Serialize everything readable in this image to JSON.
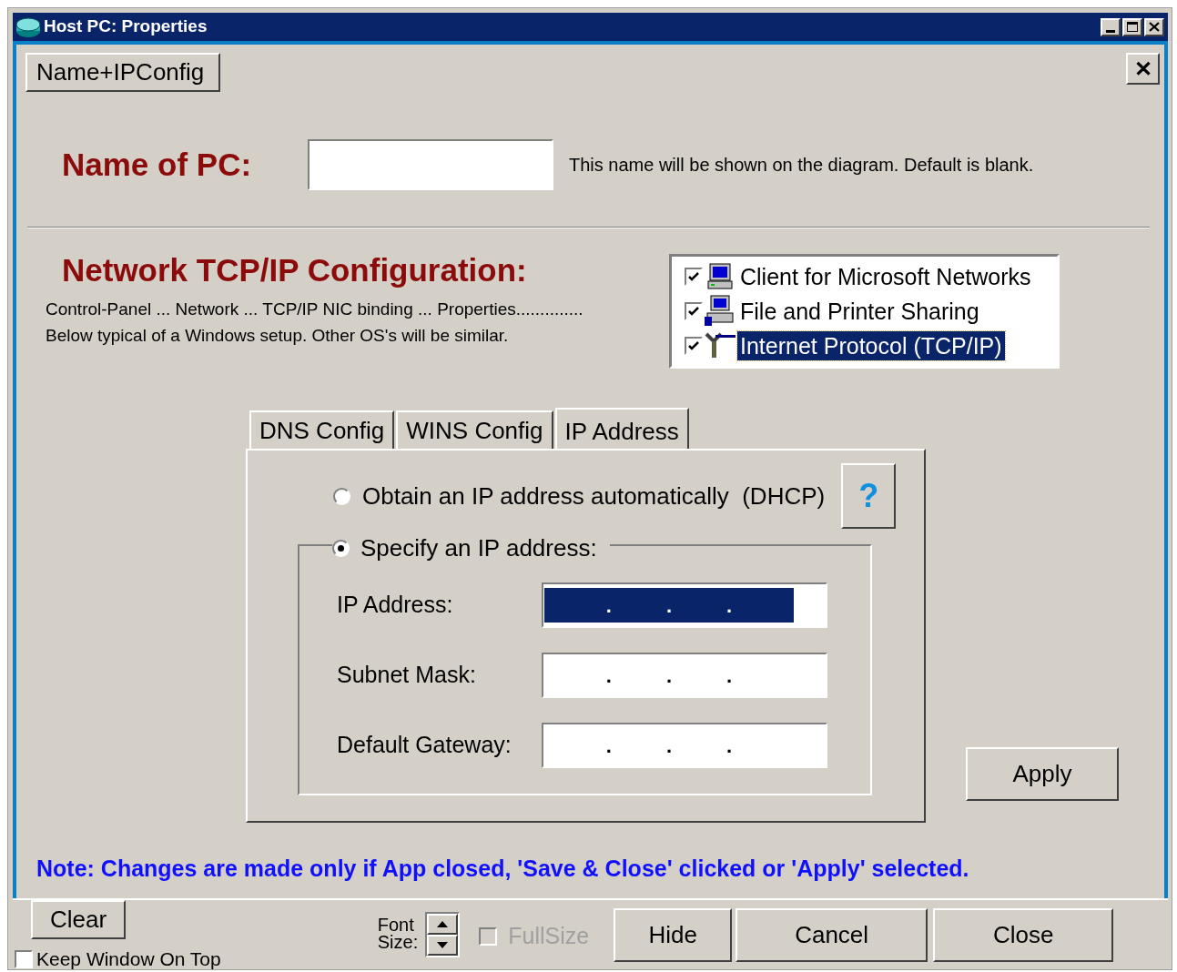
{
  "window": {
    "title": "Host PC: Properties"
  },
  "tabs": [
    {
      "label": "Name+IPConfig",
      "selected": true
    }
  ],
  "close_panel": "✕",
  "name_section": {
    "heading": "Name of PC:",
    "hint": "This name will be shown on the diagram.  Default is blank."
  },
  "network_section": {
    "heading": "Network TCP/IP Configuration:",
    "lines": [
      "Control-Panel ... Network ... TCP/IP NIC binding ... Properties..............",
      "Below typical of a Windows setup.  Other OS's will be similar."
    ]
  },
  "bindings": [
    {
      "label": "Client for Microsoft Networks",
      "checked": true,
      "selected": false,
      "kind": "computer"
    },
    {
      "label": "File and Printer Sharing",
      "checked": true,
      "selected": false,
      "kind": "printer"
    },
    {
      "label": "Internet Protocol (TCP/IP)",
      "checked": true,
      "selected": true,
      "kind": "network"
    }
  ],
  "ip_tabs": [
    {
      "label": "DNS Config",
      "selected": false
    },
    {
      "label": "WINS Config",
      "selected": false
    },
    {
      "label": "IP Address",
      "selected": true
    }
  ],
  "ip_options": [
    {
      "label": "Obtain an IP address automatically  (DHCP)",
      "selected": false
    },
    {
      "label": "Specify an IP address:",
      "selected": true
    }
  ],
  "help_button": "?",
  "fields": [
    {
      "label": "IP Address:",
      "separators": [
        ".",
        ".",
        "."
      ],
      "selected": true
    },
    {
      "label": "Subnet Mask:",
      "separators": [
        ".",
        ".",
        "."
      ],
      "selected": false
    },
    {
      "label": "Default Gateway:",
      "separators": [
        ".",
        ".",
        "."
      ],
      "selected": false
    }
  ],
  "apply_button": "Apply",
  "note": "Note: Changes are made only if App closed, 'Save & Close' clicked or 'Apply' selected.",
  "footer": {
    "clear_button": "Clear",
    "keep_on_top": {
      "label": "Keep Window On Top",
      "checked": false
    },
    "font_size_label": [
      "Font",
      "Size:"
    ],
    "full_size": {
      "label": "FullSize",
      "checked": false,
      "disabled": true
    },
    "buttons": [
      "Hide",
      "Cancel",
      "Close"
    ]
  }
}
